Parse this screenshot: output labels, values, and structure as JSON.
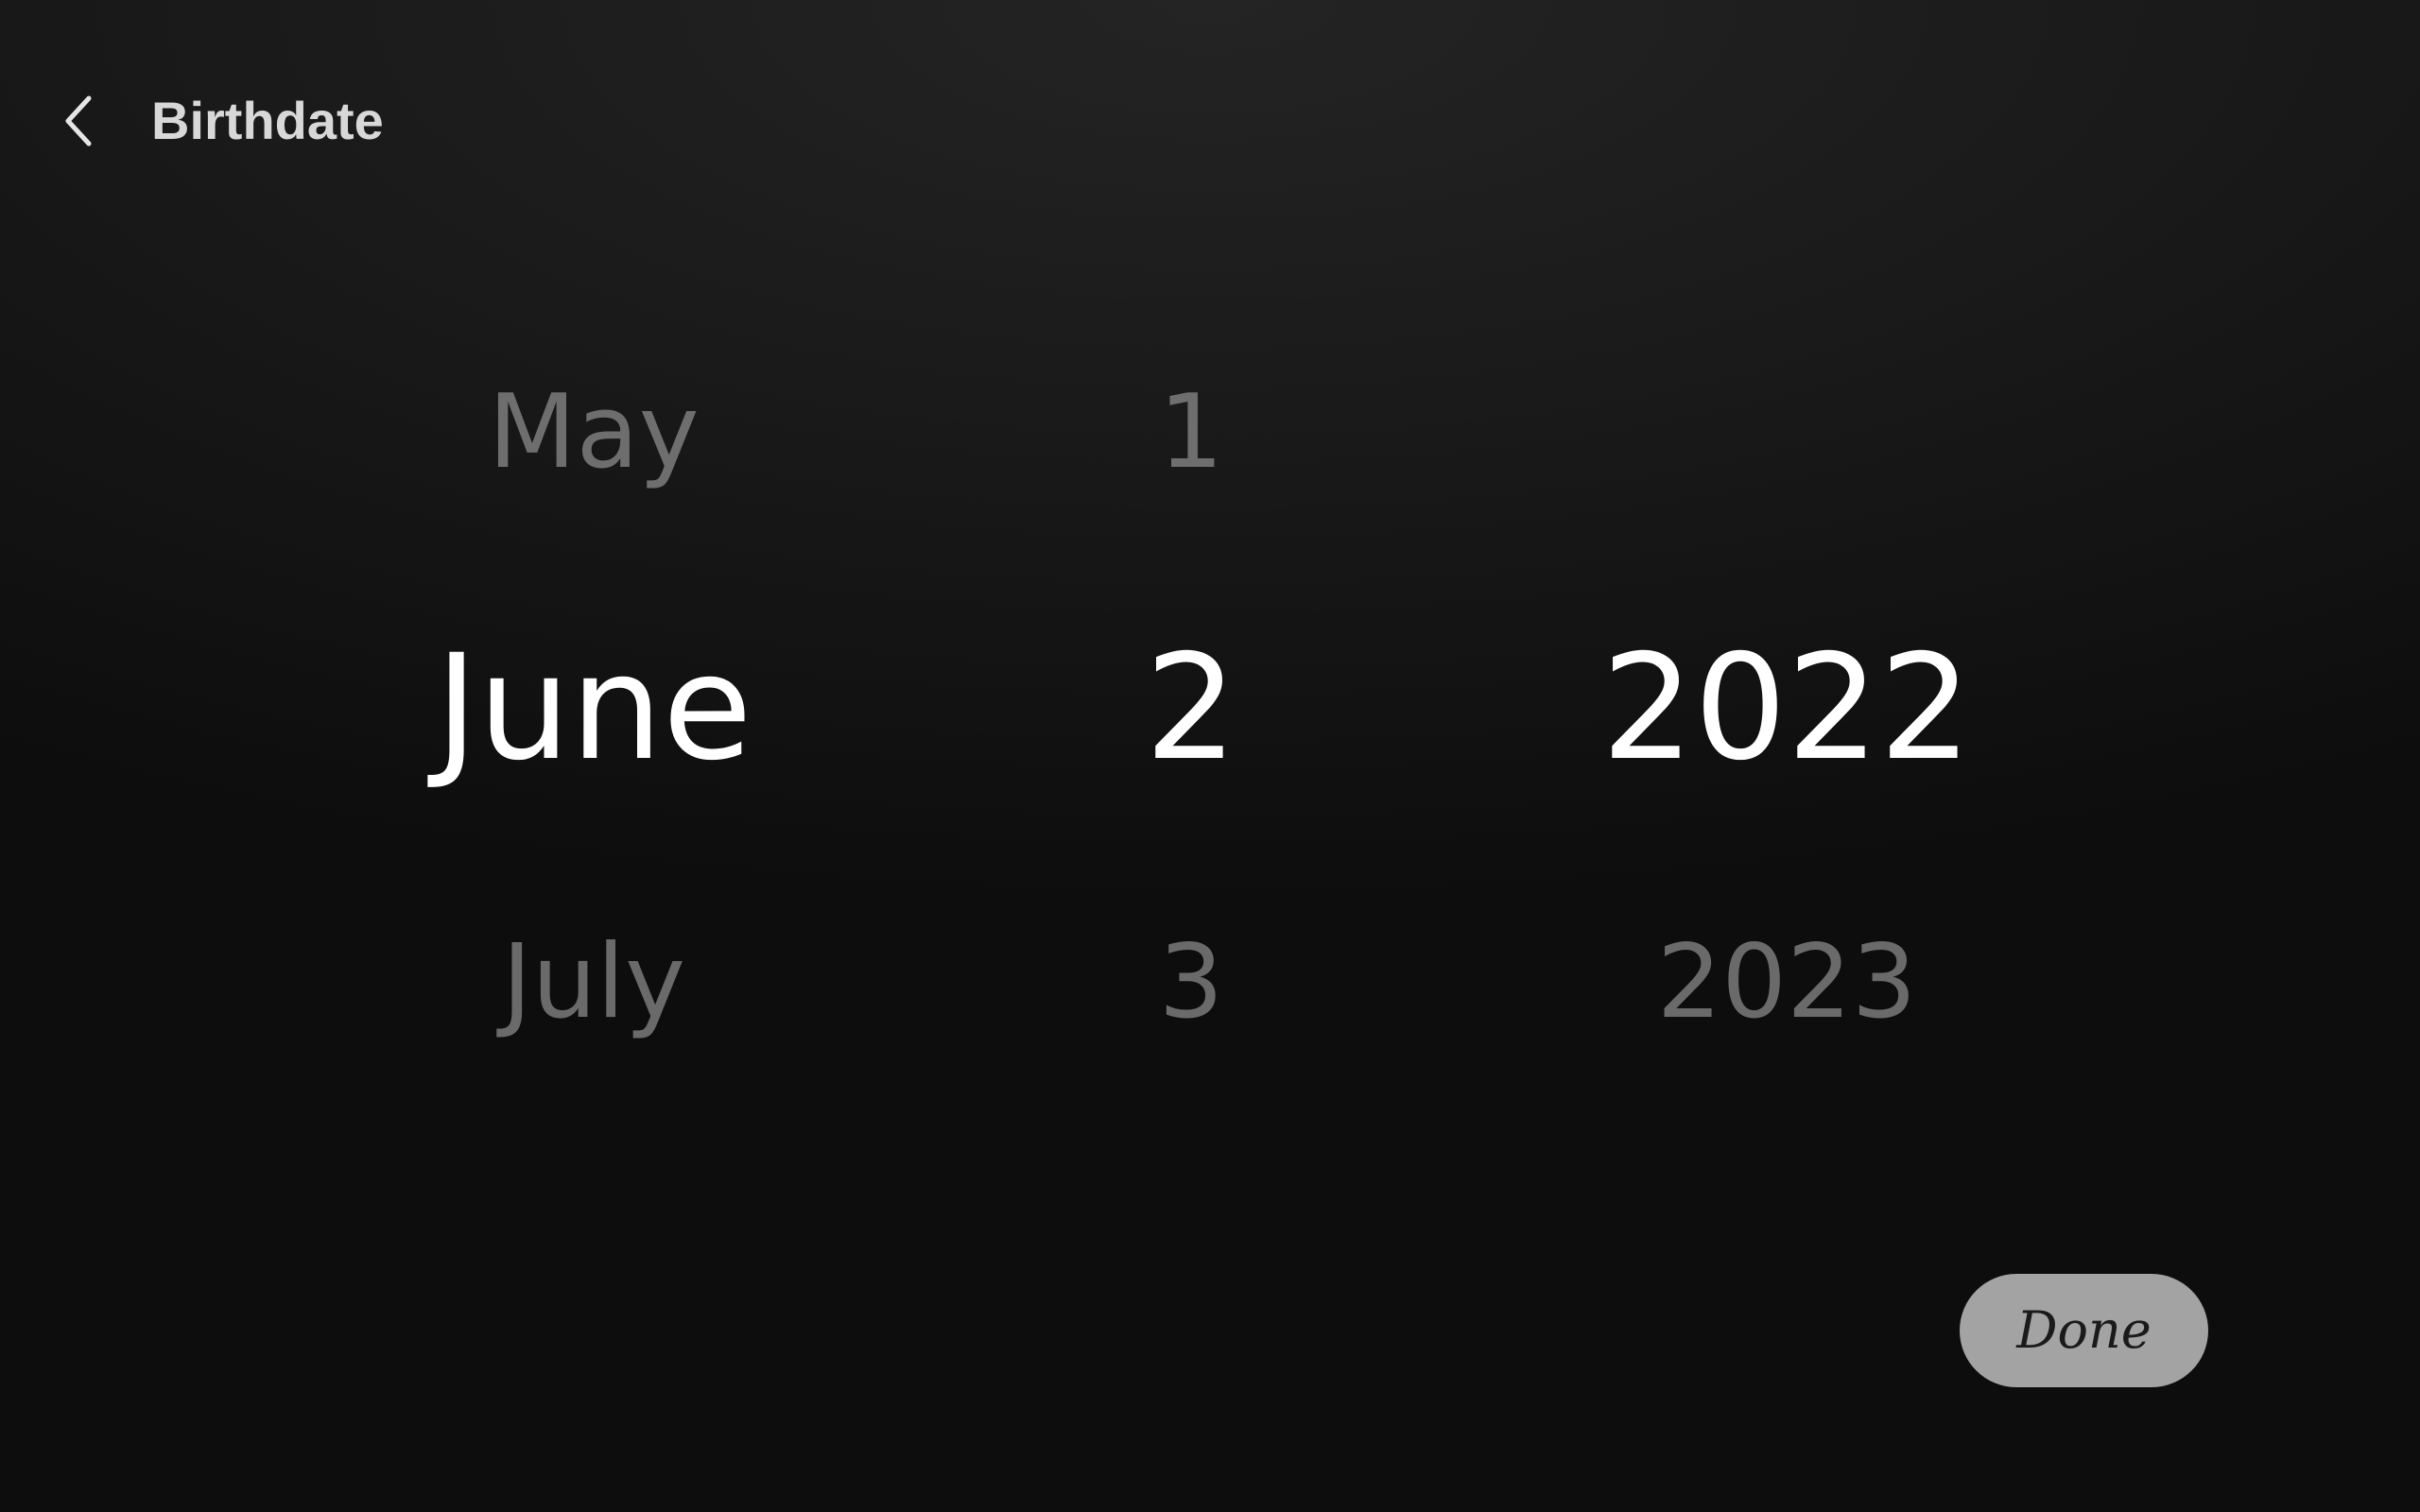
{
  "header": {
    "title": "Birthdate",
    "back_icon": "chevron-left-icon"
  },
  "picker": {
    "month": {
      "previous": "May",
      "selected": "June",
      "next": "July"
    },
    "day": {
      "previous": "1",
      "selected": "2",
      "next": "3"
    },
    "year": {
      "previous": "",
      "selected": "2022",
      "next": "2023"
    }
  },
  "actions": {
    "done_label": "Done"
  },
  "colors": {
    "background_top": "#242424",
    "background_bottom": "#0d0d0d",
    "selected_text": "#ffffff",
    "unselected_text": "#6e6e6e",
    "title_text": "#d8d8d8",
    "done_button_bg": "#a3a3a3",
    "done_button_text": "#1a1a1a"
  }
}
